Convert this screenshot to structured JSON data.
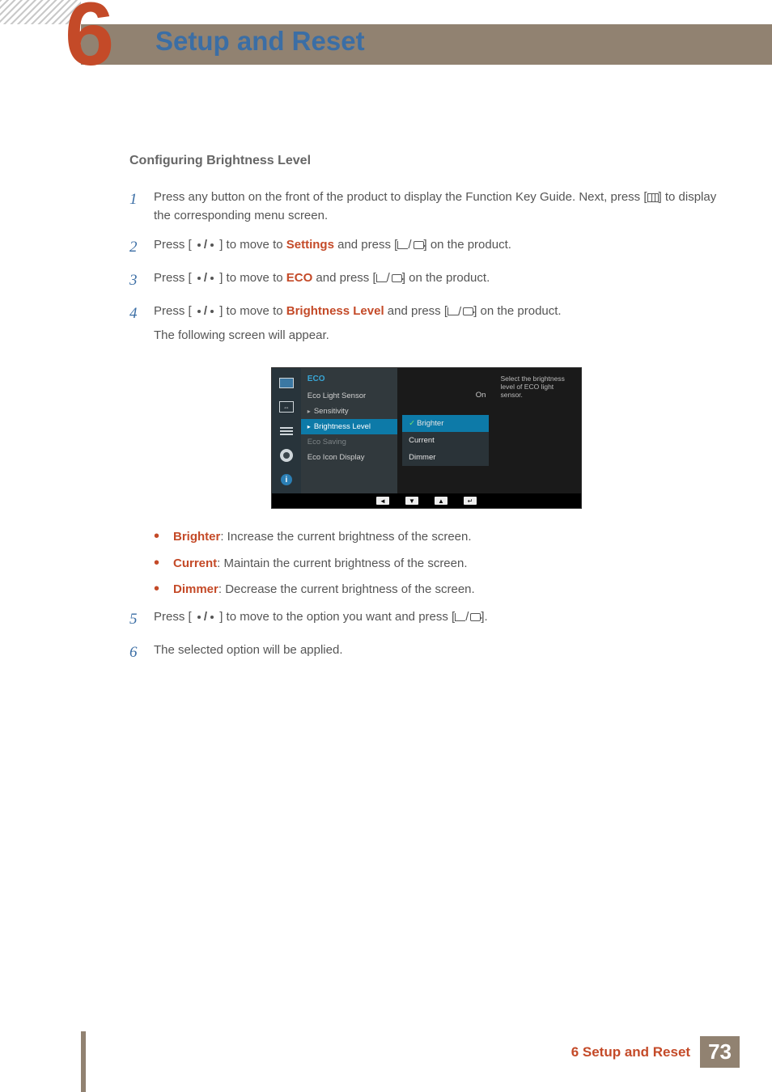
{
  "header": {
    "chapter_number": "6",
    "title": "Setup and Reset"
  },
  "subheading": "Configuring Brightness Level",
  "steps": {
    "s1_a": "Press any button on the front of the product to display the Function Key Guide. Next, press [",
    "s1_b": "] to display the corresponding menu screen.",
    "s2_a": "Press [",
    "s2_b": "] to move to ",
    "s2_hl": "Settings",
    "s2_c": " and press [",
    "s2_d": "] on the product.",
    "s3_a": "Press [",
    "s3_b": "] to move to ",
    "s3_hl": "ECO",
    "s3_c": " and press [",
    "s3_d": "] on the product.",
    "s4_a": "Press [",
    "s4_b": "] to move to ",
    "s4_hl": "Brightness Level",
    "s4_c": " and press [",
    "s4_d": "] on the product.",
    "s4_follow": "The following screen will appear.",
    "s5_a": "Press [",
    "s5_b": "] to move to the option you want and press [",
    "s5_c": "].",
    "s6": "The selected option will be applied."
  },
  "osd": {
    "title": "ECO",
    "items": {
      "eco_light_sensor": "Eco Light Sensor",
      "sensitivity": "Sensitivity",
      "brightness_level": "Brightness Level",
      "eco_saving": "Eco Saving",
      "eco_icon_display": "Eco Icon Display"
    },
    "value_on": "On",
    "options": {
      "brighter": "Brighter",
      "current": "Current",
      "dimmer": "Dimmer"
    },
    "desc": "Select the brightness level of ECO light sensor.",
    "info_glyph": "i"
  },
  "bullets": {
    "b1_hl": "Brighter",
    "b1": ": Increase the current brightness of the screen.",
    "b2_hl": "Current",
    "b2": ": Maintain the current brightness of the screen.",
    "b3_hl": "Dimmer",
    "b3": ": Decrease the current brightness of the screen."
  },
  "footer": {
    "text": "6 Setup and Reset",
    "page": "73"
  },
  "nav_glyphs": {
    "left": "◄",
    "down": "▼",
    "up": "▲",
    "enter": "↵",
    "arrows": "⇔"
  }
}
